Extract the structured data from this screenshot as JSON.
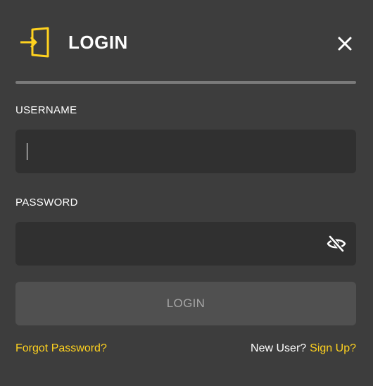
{
  "header": {
    "title": "LOGIN",
    "icon": "door-enter-icon",
    "close_icon": "close-icon"
  },
  "form": {
    "username": {
      "label": "USERNAME",
      "value": "",
      "placeholder": ""
    },
    "password": {
      "label": "PASSWORD",
      "value": "",
      "placeholder": "",
      "toggle_icon": "eye-slash-icon"
    },
    "submit_label": "LOGIN"
  },
  "footer": {
    "forgot_password": "Forgot Password?",
    "new_user_text": "New User?",
    "signup_link": "Sign Up?"
  },
  "colors": {
    "background": "#3d3d3d",
    "input_background": "#303030",
    "button_background": "#505050",
    "accent": "#ffd21f",
    "divider": "#7a7a7a",
    "text": "#ffffff",
    "button_text_disabled": "#a6a6a6"
  }
}
